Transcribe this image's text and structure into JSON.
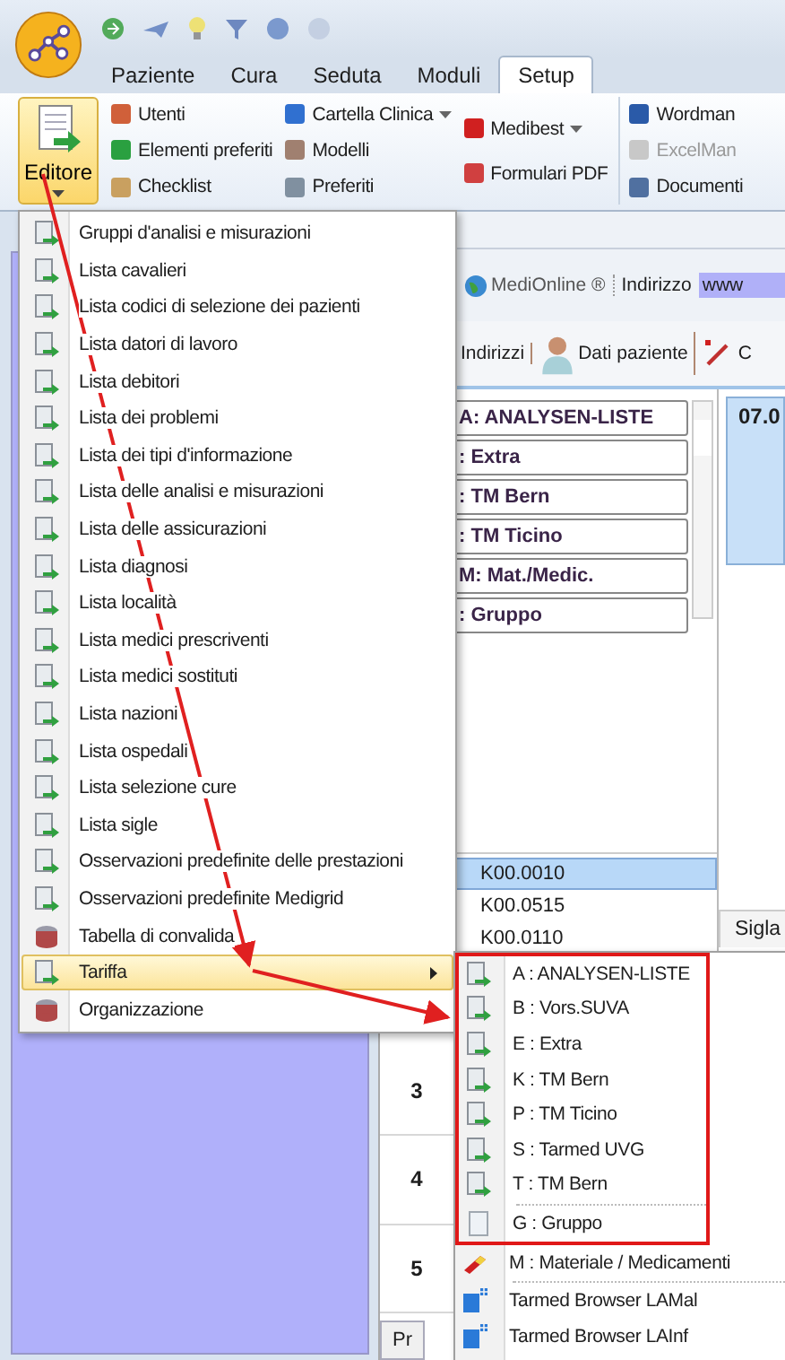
{
  "ribbon": {
    "tabs": [
      {
        "label": "Paziente",
        "selected": false
      },
      {
        "label": "Cura",
        "selected": false
      },
      {
        "label": "Seduta",
        "selected": false
      },
      {
        "label": "Moduli",
        "selected": false
      },
      {
        "label": "Setup",
        "selected": true
      }
    ],
    "editor_button": {
      "label": "Editore",
      "pressed": true
    },
    "groups": [
      {
        "items": [
          {
            "label": "Utenti",
            "dropdown": false,
            "disabled": false
          },
          {
            "label": "Elementi preferiti",
            "dropdown": false,
            "disabled": false
          },
          {
            "label": "Checklist",
            "dropdown": false,
            "disabled": false
          }
        ]
      },
      {
        "items": [
          {
            "label": "Cartella Clinica",
            "dropdown": true,
            "disabled": false
          },
          {
            "label": "Modelli",
            "dropdown": false,
            "disabled": false
          },
          {
            "label": "Preferiti",
            "dropdown": false,
            "disabled": false
          }
        ]
      },
      {
        "items": [
          {
            "label": "Medibest",
            "dropdown": true,
            "disabled": false
          },
          {
            "label": "Formulari PDF",
            "dropdown": false,
            "disabled": false
          }
        ]
      },
      {
        "items": [
          {
            "label": "Wordman",
            "dropdown": false,
            "disabled": false
          },
          {
            "label": "ExcelMan",
            "dropdown": false,
            "disabled": true
          },
          {
            "label": "Documenti",
            "dropdown": false,
            "disabled": false
          }
        ]
      }
    ]
  },
  "toolbar": {
    "medionline": "MediOnline ®",
    "address_label": "Indirizzo",
    "address_value": "www"
  },
  "patient_toolbar": [
    {
      "label": "Indirizzi",
      "kind": "text"
    },
    {
      "label": "Dati paziente",
      "kind": "patient"
    },
    {
      "label": "C",
      "kind": "syringe"
    }
  ],
  "catalog_buttons": [
    "A: ANALYSEN-LISTE",
    ": Extra",
    ": TM Bern",
    ": TM Ticino",
    "M: Mat./Medic.",
    ": Gruppo"
  ],
  "codes": [
    {
      "label": "K00.0010",
      "selected": true
    },
    {
      "label": "K00.0515",
      "selected": false
    },
    {
      "label": "K00.0110",
      "selected": false
    }
  ],
  "appointment_card": {
    "label": "07.0"
  },
  "column_header": "Sigla",
  "row_numbers": [
    "3",
    "4",
    "5"
  ],
  "bottom_tab": "Pr",
  "menu": {
    "items": [
      {
        "label": "Gruppi d'analisi e misurazioni",
        "kind": "list",
        "selected": false
      },
      {
        "label": "Lista cavalieri",
        "kind": "list",
        "selected": false
      },
      {
        "label": "Lista codici di selezione dei pazienti",
        "kind": "list",
        "selected": false
      },
      {
        "label": "Lista datori di lavoro",
        "kind": "list",
        "selected": false
      },
      {
        "label": "Lista debitori",
        "kind": "list",
        "selected": false
      },
      {
        "label": "Lista dei problemi",
        "kind": "list",
        "selected": false
      },
      {
        "label": "Lista dei tipi d'informazione",
        "kind": "list",
        "selected": false
      },
      {
        "label": "Lista delle analisi e misurazioni",
        "kind": "list",
        "selected": false
      },
      {
        "label": "Lista delle assicurazioni",
        "kind": "list",
        "selected": false
      },
      {
        "label": "Lista diagnosi",
        "kind": "list",
        "selected": false
      },
      {
        "label": "Lista località",
        "kind": "list",
        "selected": false
      },
      {
        "label": "Lista medici prescriventi",
        "kind": "list",
        "selected": false
      },
      {
        "label": "Lista medici sostituti",
        "kind": "list",
        "selected": false
      },
      {
        "label": "Lista nazioni",
        "kind": "list",
        "selected": false
      },
      {
        "label": "Lista ospedali",
        "kind": "list",
        "selected": false
      },
      {
        "label": "Lista selezione cure",
        "kind": "list",
        "selected": false
      },
      {
        "label": "Lista sigle",
        "kind": "list",
        "selected": false
      },
      {
        "label": "Osservazioni predefinite delle prestazioni",
        "kind": "list",
        "selected": false
      },
      {
        "label": "Osservazioni predefinite Medigrid",
        "kind": "list",
        "selected": false
      },
      {
        "label": "Tabella di convalida",
        "kind": "table",
        "selected": false
      },
      {
        "label": "Tariffa",
        "kind": "submenu",
        "selected": true
      },
      {
        "label": "Organizzazione",
        "kind": "table",
        "selected": false
      }
    ]
  },
  "submenu": {
    "framed_items": [
      {
        "label": "A : ANALYSEN-LISTE",
        "kind": "tariff",
        "separator_before": false
      },
      {
        "label": "B : Vors.SUVA",
        "kind": "tariff",
        "separator_before": false
      },
      {
        "label": "E : Extra",
        "kind": "tariff",
        "separator_before": false
      },
      {
        "label": "K : TM Bern",
        "kind": "tariff",
        "separator_before": false
      },
      {
        "label": "P : TM Ticino",
        "kind": "tariff",
        "separator_before": false
      },
      {
        "label": "S : Tarmed UVG",
        "kind": "tariff",
        "separator_before": false
      },
      {
        "label": "T : TM Bern",
        "kind": "tariff",
        "separator_before": false
      },
      {
        "label": "G : Gruppo",
        "kind": "group",
        "separator_before": true
      }
    ],
    "items": [
      {
        "label": "M : Materiale / Medicamenti",
        "kind": "material",
        "separator_before": false
      },
      {
        "label": "Tarmed Browser LAMal",
        "kind": "browser",
        "separator_before": true
      },
      {
        "label": "Tarmed Browser LAInf",
        "kind": "browser",
        "separator_before": false
      }
    ]
  }
}
